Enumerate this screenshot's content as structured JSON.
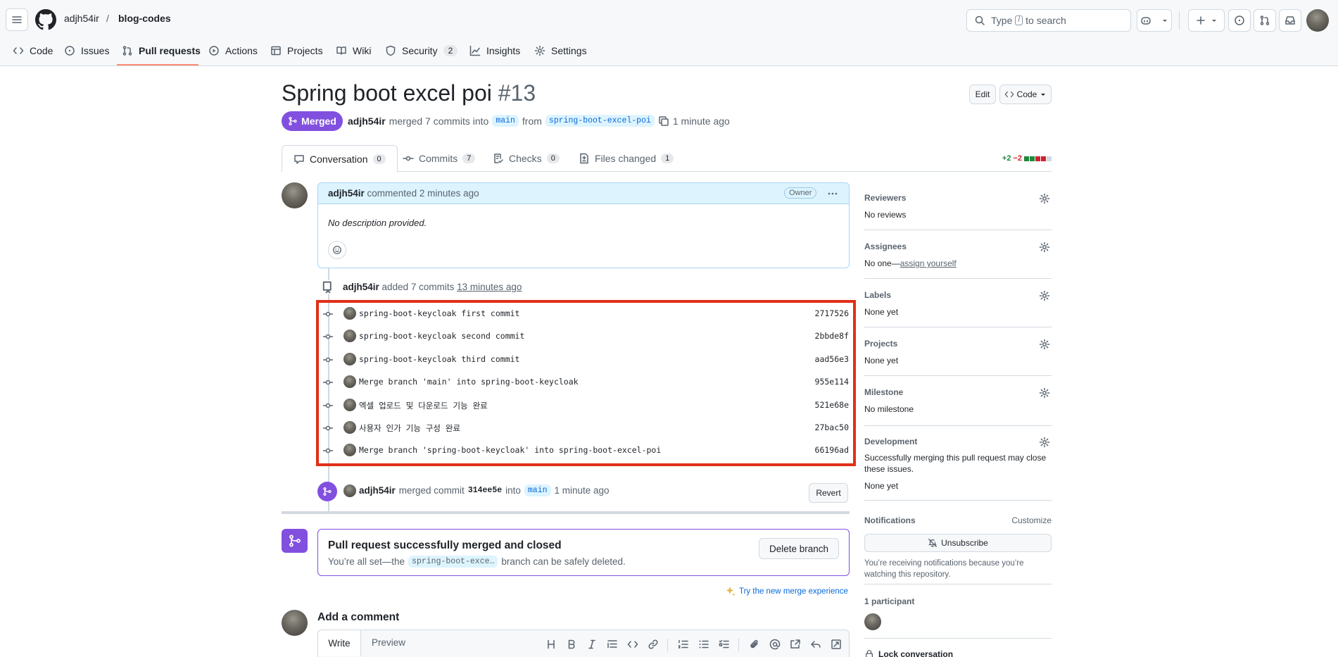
{
  "repo": {
    "owner": "adjh54ir",
    "separator": "/",
    "name": "blog-codes"
  },
  "search": {
    "prefix": "Type",
    "key": "/",
    "suffix": "to search"
  },
  "nav_tabs": [
    {
      "label": "Code",
      "icon": "code-icon"
    },
    {
      "label": "Issues",
      "icon": "issue-icon"
    },
    {
      "label": "Pull requests",
      "icon": "pull-request-icon"
    },
    {
      "label": "Actions",
      "icon": "play-icon"
    },
    {
      "label": "Projects",
      "icon": "table-icon"
    },
    {
      "label": "Wiki",
      "icon": "book-icon"
    },
    {
      "label": "Security",
      "icon": "shield-icon",
      "count": "2"
    },
    {
      "label": "Insights",
      "icon": "graph-icon"
    },
    {
      "label": "Settings",
      "icon": "gear-icon"
    }
  ],
  "pr": {
    "title": "Spring boot excel poi",
    "number": "#13",
    "edit_label": "Edit",
    "code_label": "Code",
    "state": "Merged",
    "author": "adjh54ir",
    "merge_text": "merged 7 commits into",
    "base": "main",
    "from_text": "from",
    "head": "spring-boot-excel-poi",
    "time": "1 minute ago"
  },
  "pr_tabs": [
    {
      "label": "Conversation",
      "count": "0",
      "icon": "comment-icon"
    },
    {
      "label": "Commits",
      "count": "7",
      "icon": "commit-icon"
    },
    {
      "label": "Checks",
      "count": "0",
      "icon": "checklist-icon"
    },
    {
      "label": "Files changed",
      "count": "1",
      "icon": "diff-icon"
    }
  ],
  "diffstat": {
    "added": "+2",
    "removed": "−2",
    "colors": [
      "#1f883d",
      "#1f883d",
      "#cf222e",
      "#cf222e",
      "#d1d9e0"
    ]
  },
  "comment": {
    "author": "adjh54ir",
    "action": "commented",
    "time": "2 minutes ago",
    "role": "Owner",
    "body": "No description provided."
  },
  "commits_event": {
    "author": "adjh54ir",
    "action": "added 7 commits",
    "time": "13 minutes ago"
  },
  "commits": [
    {
      "message": "spring-boot-keycloak first commit",
      "sha": "2717526"
    },
    {
      "message": "spring-boot-keycloak second commit",
      "sha": "2bbde8f"
    },
    {
      "message": "spring-boot-keycloak third commit",
      "sha": "aad56e3"
    },
    {
      "message": "Merge branch 'main' into spring-boot-keycloak",
      "sha": "955e114"
    },
    {
      "message": "엑셀 업로드 및 다운로드 기능 완료",
      "sha": "521e68e"
    },
    {
      "message": "사용자 인가 기능 구성 완료",
      "sha": "27bac50"
    },
    {
      "message": "Merge branch 'spring-boot-keycloak' into spring-boot-excel-poi",
      "sha": "66196ad"
    }
  ],
  "merge_event": {
    "author": "adjh54ir",
    "action": "merged commit",
    "sha": "314ee5e",
    "into": "into",
    "branch": "main",
    "time": "1 minute ago",
    "revert_label": "Revert"
  },
  "merged_box": {
    "title": "Pull request successfully merged and closed",
    "text_before": "You’re all set—the",
    "branch": "spring-boot-exce…",
    "text_after": "branch can be safely deleted.",
    "delete_label": "Delete branch"
  },
  "try_merge": "Try the new merge experience",
  "add_comment": {
    "title": "Add a comment",
    "write": "Write",
    "preview": "Preview"
  },
  "sidebar": {
    "reviewers": {
      "title": "Reviewers",
      "value": "No reviews"
    },
    "assignees": {
      "title": "Assignees",
      "value": "No one—",
      "link": "assign yourself"
    },
    "labels": {
      "title": "Labels",
      "value": "None yet"
    },
    "projects": {
      "title": "Projects",
      "value": "None yet"
    },
    "milestone": {
      "title": "Milestone",
      "value": "No milestone"
    },
    "development": {
      "title": "Development",
      "desc": "Successfully merging this pull request may close these issues.",
      "value": "None yet"
    },
    "notifications": {
      "title": "Notifications",
      "customize": "Customize",
      "button": "Unsubscribe",
      "desc": "You’re receiving notifications because you’re watching this repository."
    },
    "participants": {
      "title": "1 participant"
    },
    "lock": {
      "label": "Lock conversation"
    }
  }
}
